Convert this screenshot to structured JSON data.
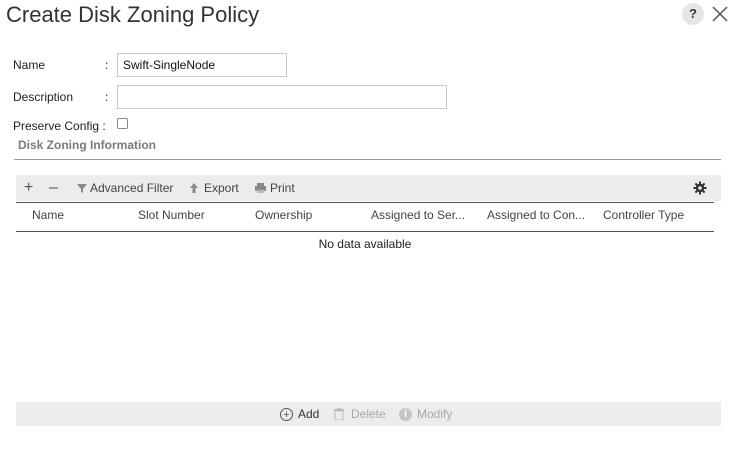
{
  "dialog": {
    "title": "Create Disk Zoning Policy",
    "help_label": "?"
  },
  "form": {
    "name_label": "Name",
    "name_value": "Swift-SingleNode",
    "description_label": "Description",
    "description_value": "",
    "preserve_label": "Preserve Config",
    "preserve_checked": false,
    "colon": ":"
  },
  "section": {
    "title": "Disk Zoning Information"
  },
  "toolbar": {
    "add_glyph": "+",
    "remove_glyph": "–",
    "filter_label": "Advanced Filter",
    "export_label": "Export",
    "print_label": "Print"
  },
  "table": {
    "columns": [
      "Name",
      "Slot Number",
      "Ownership",
      "Assigned to Ser...",
      "Assigned to Con...",
      "Controller Type"
    ],
    "empty_text": "No data available"
  },
  "footer": {
    "add_label": "Add",
    "delete_label": "Delete",
    "modify_label": "Modify"
  },
  "colors": {
    "toolbar_bg": "#ececec",
    "disabled_text": "#a8a8a8",
    "section_title": "#7a7a7a"
  }
}
